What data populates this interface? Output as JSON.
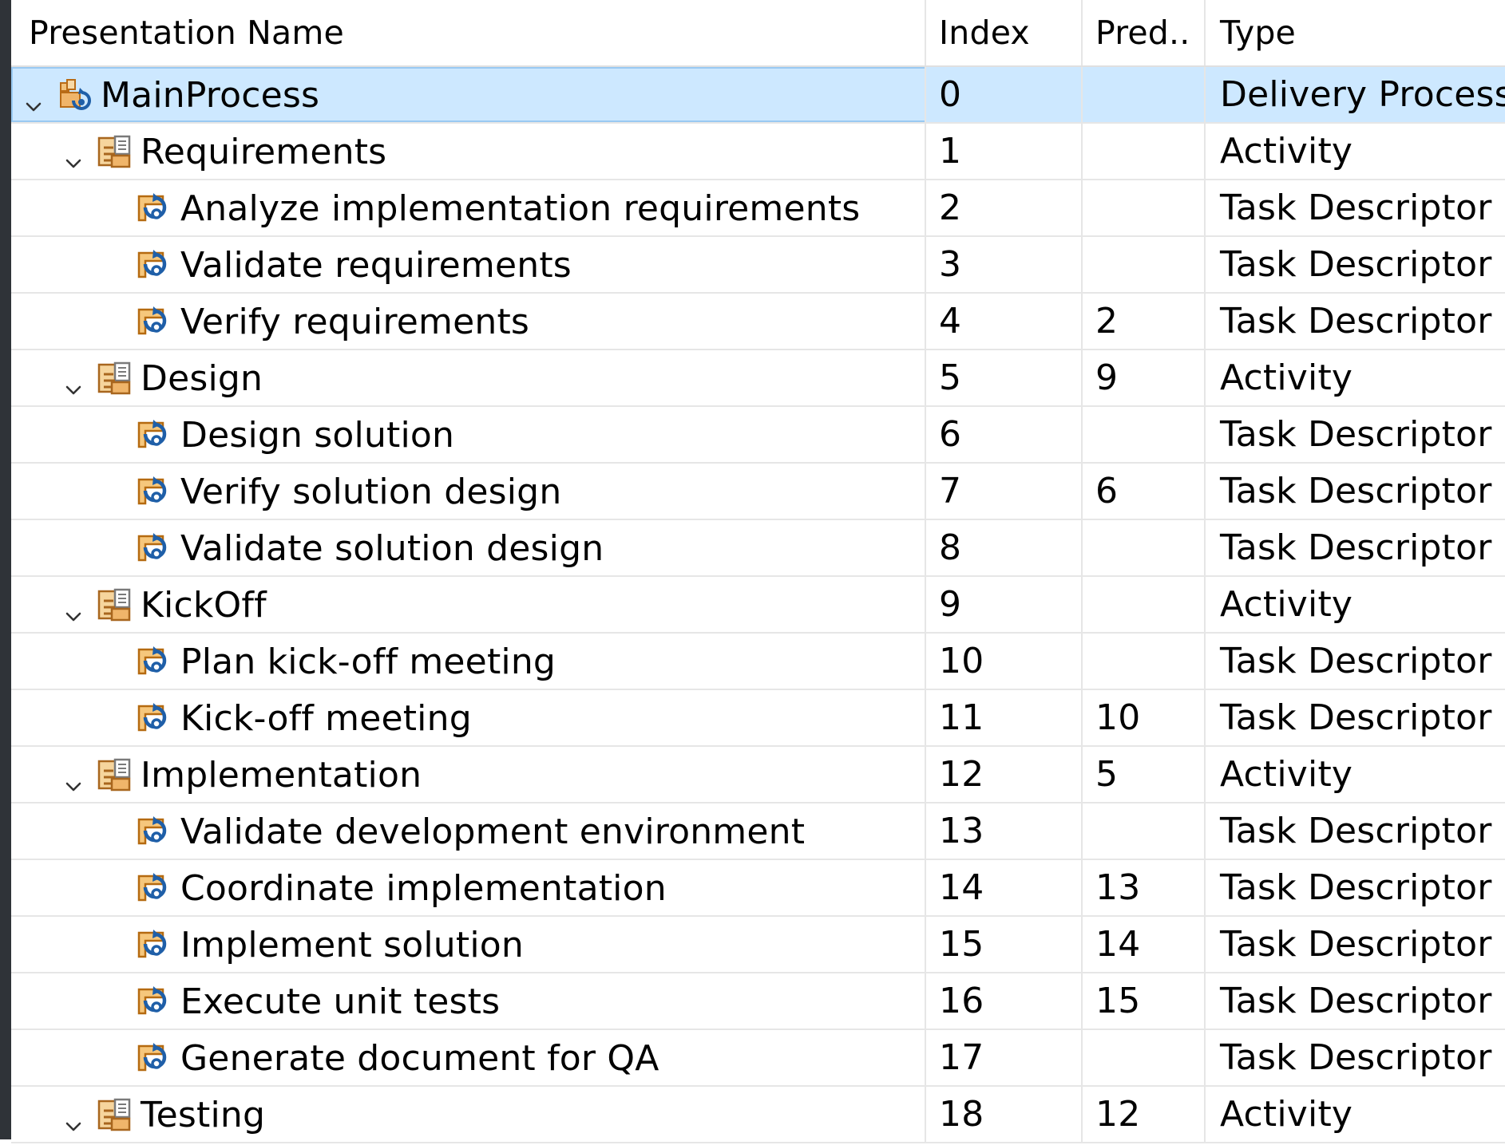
{
  "columns": {
    "name": "Presentation Name",
    "index": "Index",
    "pred": "Pred..",
    "type": "Type"
  },
  "rows": [
    {
      "name": "MainProcess",
      "index": "0",
      "pred": "",
      "type": "Delivery Process",
      "icon": "delivery-process-icon",
      "level": 0,
      "expandable": true,
      "selected": true
    },
    {
      "name": "Requirements",
      "index": "1",
      "pred": "",
      "type": "Activity",
      "icon": "activity-icon",
      "level": 1,
      "expandable": true
    },
    {
      "name": "Analyze implementation requirements",
      "index": "2",
      "pred": "",
      "type": "Task Descriptor",
      "icon": "task-descriptor-icon",
      "level": 2
    },
    {
      "name": "Validate requirements",
      "index": "3",
      "pred": "",
      "type": "Task Descriptor",
      "icon": "task-descriptor-icon",
      "level": 2
    },
    {
      "name": "Verify requirements",
      "index": "4",
      "pred": "2",
      "type": "Task Descriptor",
      "icon": "task-descriptor-icon",
      "level": 2
    },
    {
      "name": "Design",
      "index": "5",
      "pred": "9",
      "type": "Activity",
      "icon": "activity-icon",
      "level": 1,
      "expandable": true
    },
    {
      "name": "Design solution",
      "index": "6",
      "pred": "",
      "type": "Task Descriptor",
      "icon": "task-descriptor-icon",
      "level": 2
    },
    {
      "name": "Verify solution design",
      "index": "7",
      "pred": "6",
      "type": "Task Descriptor",
      "icon": "task-descriptor-icon",
      "level": 2
    },
    {
      "name": "Validate solution design",
      "index": "8",
      "pred": "",
      "type": "Task Descriptor",
      "icon": "task-descriptor-icon",
      "level": 2
    },
    {
      "name": "KickOff",
      "index": "9",
      "pred": "",
      "type": "Activity",
      "icon": "activity-icon",
      "level": 1,
      "expandable": true
    },
    {
      "name": "Plan kick-off meeting",
      "index": "10",
      "pred": "",
      "type": "Task Descriptor",
      "icon": "task-descriptor-icon",
      "level": 2
    },
    {
      "name": "Kick-off meeting",
      "index": "11",
      "pred": "10",
      "type": "Task Descriptor",
      "icon": "task-descriptor-icon",
      "level": 2
    },
    {
      "name": "Implementation",
      "index": "12",
      "pred": "5",
      "type": "Activity",
      "icon": "activity-icon",
      "level": 1,
      "expandable": true
    },
    {
      "name": "Validate development environment",
      "index": "13",
      "pred": "",
      "type": "Task Descriptor",
      "icon": "task-descriptor-icon",
      "level": 2
    },
    {
      "name": "Coordinate implementation",
      "index": "14",
      "pred": "13",
      "type": "Task Descriptor",
      "icon": "task-descriptor-icon",
      "level": 2
    },
    {
      "name": "Implement solution",
      "index": "15",
      "pred": "14",
      "type": "Task Descriptor",
      "icon": "task-descriptor-icon",
      "level": 2
    },
    {
      "name": "Execute unit tests",
      "index": "16",
      "pred": "15",
      "type": "Task Descriptor",
      "icon": "task-descriptor-icon",
      "level": 2
    },
    {
      "name": "Generate document for QA",
      "index": "17",
      "pred": "",
      "type": "Task Descriptor",
      "icon": "task-descriptor-icon",
      "level": 2
    },
    {
      "name": "Testing",
      "index": "18",
      "pred": "12",
      "type": "Activity",
      "icon": "activity-icon",
      "level": 1,
      "expandable": true
    }
  ],
  "colors": {
    "selection": "#cde8ff",
    "grid": "#e6e6e6",
    "rail": "#2f3338",
    "icon_orange": "#e8a33d",
    "icon_blue": "#1f5fa8"
  }
}
